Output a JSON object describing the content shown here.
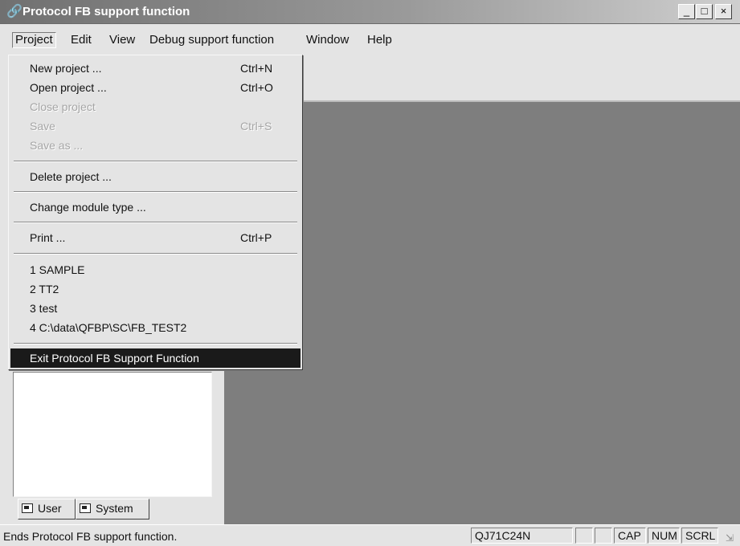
{
  "window": {
    "title": "Protocol FB support function",
    "app_icon": "link-icon",
    "minimize_label": "_",
    "maximize_label": "□",
    "close_label": "×"
  },
  "menubar": {
    "items": [
      "Project",
      "Edit",
      "View",
      "Debug support function",
      "Window",
      "Help"
    ]
  },
  "project_menu": {
    "new_project": {
      "label": "New project ...",
      "shortcut": "Ctrl+N"
    },
    "open_project": {
      "label": "Open project ...",
      "shortcut": "Ctrl+O"
    },
    "close_project": {
      "label": "Close project"
    },
    "save": {
      "label": "Save",
      "shortcut": "Ctrl+S"
    },
    "save_as": {
      "label": "Save as ..."
    },
    "delete_project": {
      "label": "Delete project ..."
    },
    "change_module_type": {
      "label": "Change module type ..."
    },
    "print": {
      "label": "Print ...",
      "shortcut": "Ctrl+P"
    },
    "recent": [
      "1 SAMPLE",
      "2 TT2",
      "3 test",
      "4 C:\\data\\QFBP\\SC\\FB_TEST2"
    ],
    "exit": {
      "label": "Exit Protocol FB Support Function"
    }
  },
  "left_panel": {
    "tabs": [
      "User",
      "System"
    ]
  },
  "statusbar": {
    "message": "Ends Protocol FB support function.",
    "module": "QJ71C24N",
    "cap": "CAP",
    "num": "NUM",
    "scrl": "SCRL"
  },
  "colors": {
    "workspace": "#7e7e7e",
    "selected_menu_item": "#1a1a1a"
  }
}
